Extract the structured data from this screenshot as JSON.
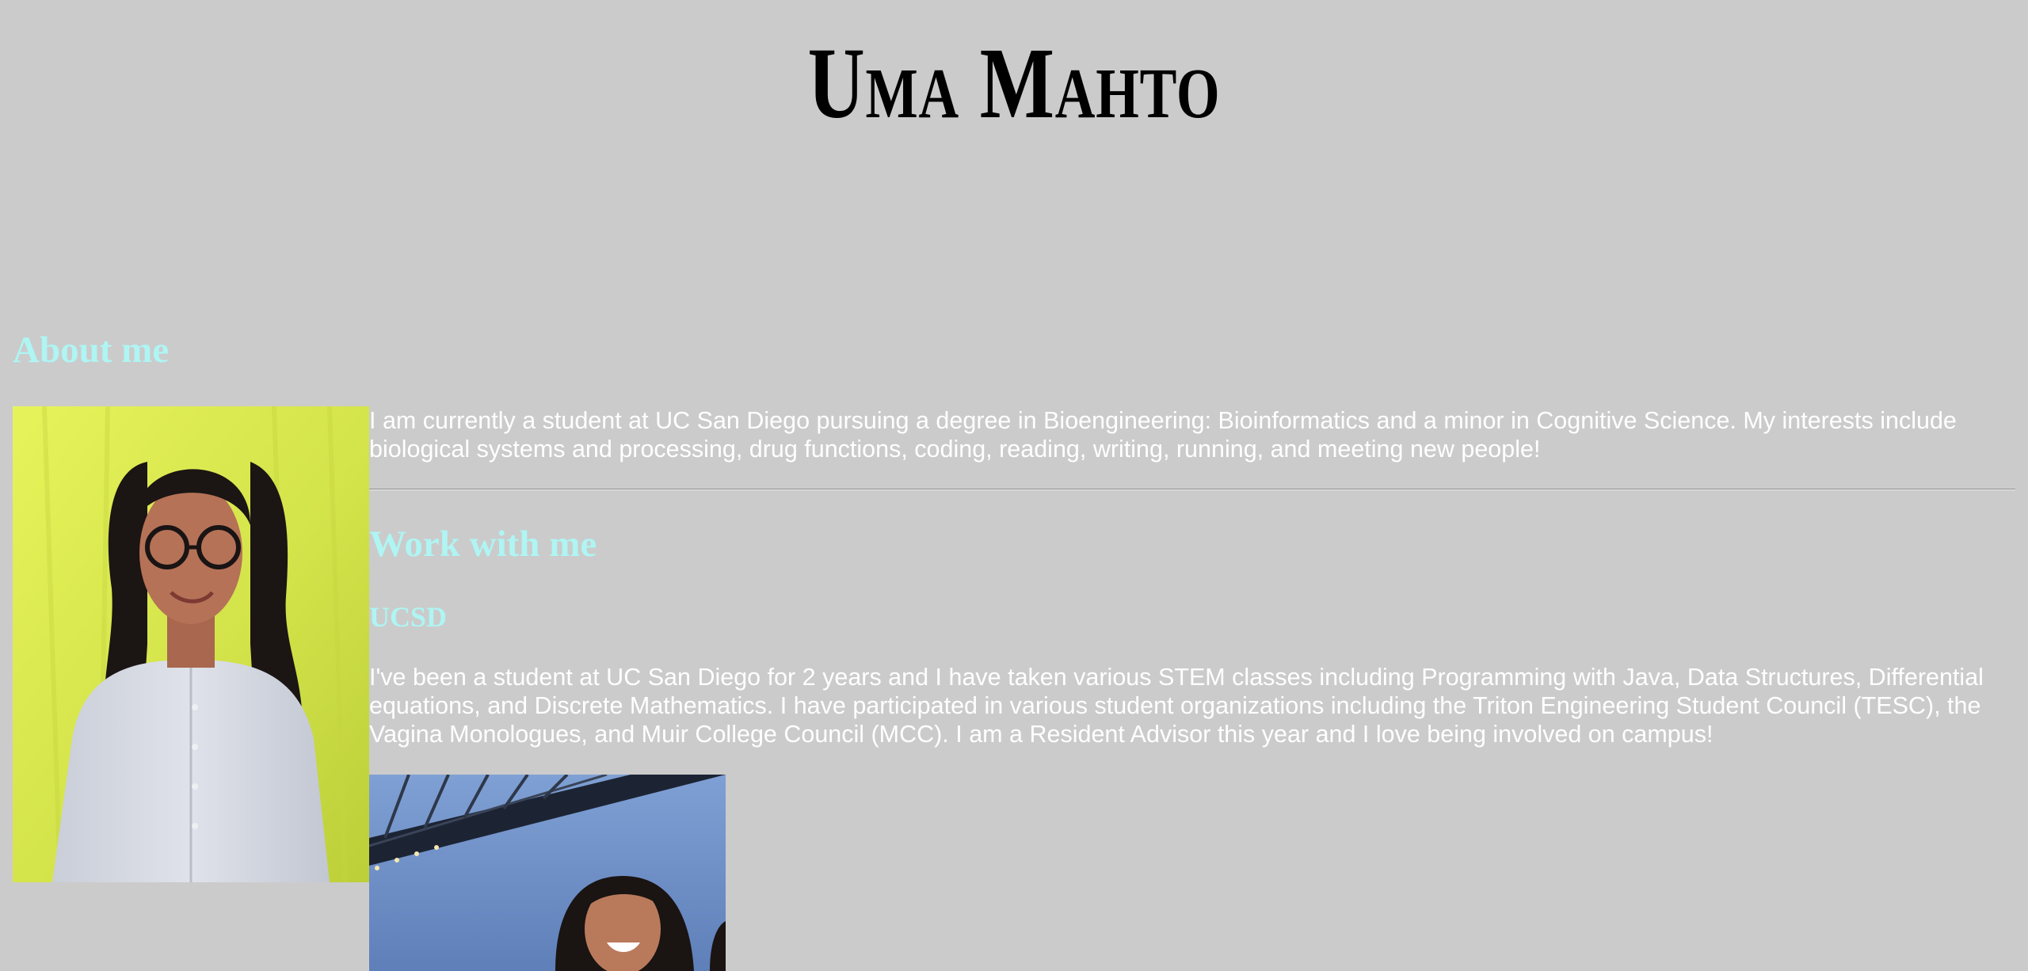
{
  "header": {
    "title": "Uma Mahto"
  },
  "about": {
    "heading": "About me",
    "photo_icon": "portrait-photo",
    "bio": "I am currently a student at UC San Diego pursuing a degree in Bioengineering: Bioinformatics and a minor in Cognitive Science. My interests include biological systems and processing, drug functions, coding, reading, writing, running, and meeting new people!"
  },
  "work": {
    "heading": "Work with me",
    "ucsd_heading": "UCSD",
    "ucsd_text": "I've been a student at UC San Diego for 2 years and I have taken various STEM classes including Programming with Java, Data Structures, Differential equations, and Discrete Mathematics. I have participated in various student organizations including the Triton Engineering Student Council (TESC), the Vagina Monologues, and Muir College Council (MCC). I am a Resident Advisor this year and I love being involved on campus!",
    "photo_icon": "bridge-photo"
  },
  "colors": {
    "background": "#cbcbcb",
    "heading": "#aef5f3",
    "body_text": "#ffffff",
    "title": "#000000"
  }
}
